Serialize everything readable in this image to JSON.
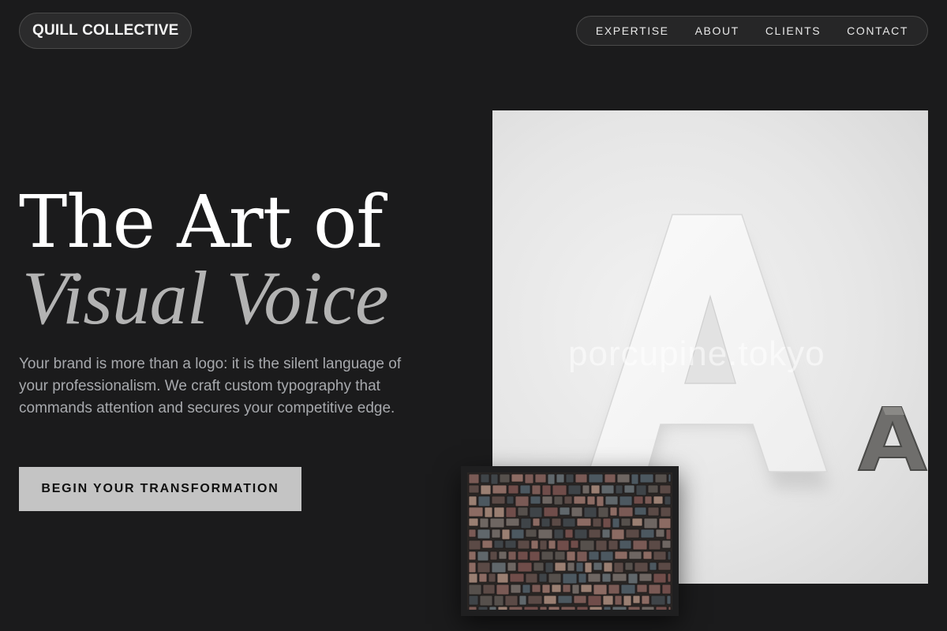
{
  "header": {
    "brand": "QUILL COLLECTIVE",
    "nav": [
      {
        "label": "EXPERTISE"
      },
      {
        "label": "ABOUT"
      },
      {
        "label": "CLIENTS"
      },
      {
        "label": "CONTACT"
      }
    ]
  },
  "hero": {
    "title_line1": "The Art of",
    "title_line2": "Visual Voice",
    "lead": "Your brand is more than a logo: it is the silent language of your professionalism. We craft custom typography that commands attention and secures your competitive edge.",
    "cta": "BEGIN YOUR TRANSFORMATION"
  },
  "images": {
    "main_alt": "large white 3D letter A with small metal letter A",
    "watermark": "porcupine.tokyo",
    "secondary_alt": "pile of vintage wooden letterpress type blocks"
  },
  "colors": {
    "background": "#1b1b1c",
    "cta_bg": "#c4c4c4",
    "title": "#ffffff",
    "title_italic": "#b3b3b3",
    "body_text": "#a7a9ad"
  }
}
